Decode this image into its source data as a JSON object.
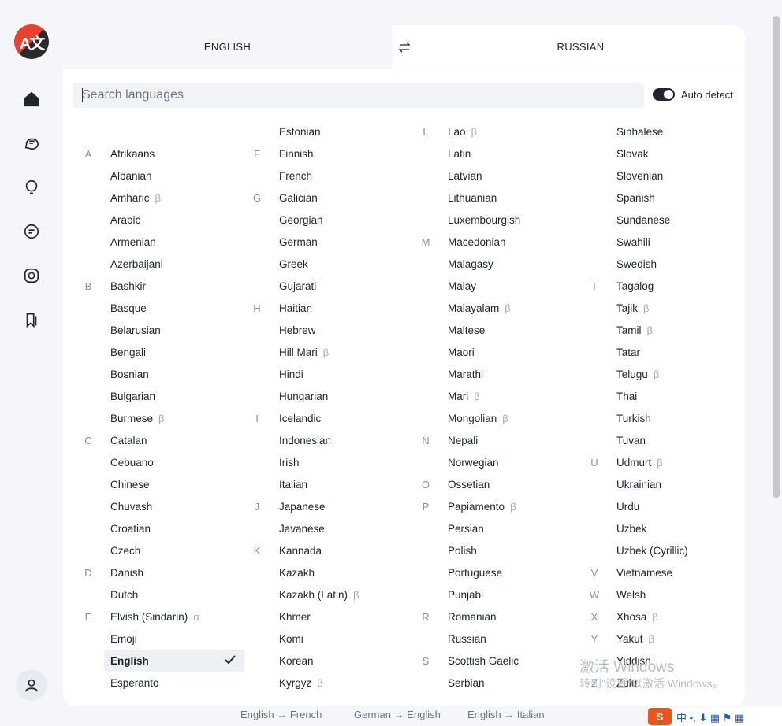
{
  "app": {
    "logo_icon": "translate-logo-icon",
    "logo_glyph": "A文"
  },
  "nav": {
    "items": [
      {
        "name": "home-icon"
      },
      {
        "name": "chat-bubbles-icon"
      },
      {
        "name": "lightbulb-icon"
      },
      {
        "name": "message-square-icon"
      },
      {
        "name": "camera-icon"
      },
      {
        "name": "bookmarks-icon"
      }
    ],
    "profile_icon": "user-icon"
  },
  "tabs": {
    "source": "ENGLISH",
    "target": "RUSSIAN",
    "swap_icon": "swap-arrows-icon"
  },
  "search": {
    "placeholder": "Search languages",
    "value": ""
  },
  "auto_detect": {
    "label": "Auto detect",
    "enabled": true
  },
  "beta_symbol": "β",
  "alpha_symbol": "α",
  "selected_language": "English",
  "columns": [
    [
      {
        "letter": "",
        "name": ""
      },
      {
        "letter": "A",
        "name": "Afrikaans"
      },
      {
        "letter": "",
        "name": "Albanian"
      },
      {
        "letter": "",
        "name": "Amharic",
        "tag": "β"
      },
      {
        "letter": "",
        "name": "Arabic"
      },
      {
        "letter": "",
        "name": "Armenian"
      },
      {
        "letter": "",
        "name": "Azerbaijani"
      },
      {
        "letter": "B",
        "name": "Bashkir"
      },
      {
        "letter": "",
        "name": "Basque"
      },
      {
        "letter": "",
        "name": "Belarusian"
      },
      {
        "letter": "",
        "name": "Bengali"
      },
      {
        "letter": "",
        "name": "Bosnian"
      },
      {
        "letter": "",
        "name": "Bulgarian"
      },
      {
        "letter": "",
        "name": "Burmese",
        "tag": "β"
      },
      {
        "letter": "C",
        "name": "Catalan"
      },
      {
        "letter": "",
        "name": "Cebuano"
      },
      {
        "letter": "",
        "name": "Chinese"
      },
      {
        "letter": "",
        "name": "Chuvash"
      },
      {
        "letter": "",
        "name": "Croatian"
      },
      {
        "letter": "",
        "name": "Czech"
      },
      {
        "letter": "D",
        "name": "Danish"
      },
      {
        "letter": "",
        "name": "Dutch"
      },
      {
        "letter": "E",
        "name": "Elvish (Sindarin)",
        "tag": "α"
      },
      {
        "letter": "",
        "name": "Emoji"
      },
      {
        "letter": "",
        "name": "English",
        "selected": true
      },
      {
        "letter": "",
        "name": "Esperanto"
      }
    ],
    [
      {
        "letter": "",
        "name": "Estonian"
      },
      {
        "letter": "F",
        "name": "Finnish"
      },
      {
        "letter": "",
        "name": "French"
      },
      {
        "letter": "G",
        "name": "Galician"
      },
      {
        "letter": "",
        "name": "Georgian"
      },
      {
        "letter": "",
        "name": "German"
      },
      {
        "letter": "",
        "name": "Greek"
      },
      {
        "letter": "",
        "name": "Gujarati"
      },
      {
        "letter": "H",
        "name": "Haitian"
      },
      {
        "letter": "",
        "name": "Hebrew"
      },
      {
        "letter": "",
        "name": "Hill Mari",
        "tag": "β"
      },
      {
        "letter": "",
        "name": "Hindi"
      },
      {
        "letter": "",
        "name": "Hungarian"
      },
      {
        "letter": "I",
        "name": "Icelandic"
      },
      {
        "letter": "",
        "name": "Indonesian"
      },
      {
        "letter": "",
        "name": "Irish"
      },
      {
        "letter": "",
        "name": "Italian"
      },
      {
        "letter": "J",
        "name": "Japanese"
      },
      {
        "letter": "",
        "name": "Javanese"
      },
      {
        "letter": "K",
        "name": "Kannada"
      },
      {
        "letter": "",
        "name": "Kazakh"
      },
      {
        "letter": "",
        "name": "Kazakh (Latin)",
        "tag": "β"
      },
      {
        "letter": "",
        "name": "Khmer"
      },
      {
        "letter": "",
        "name": "Komi"
      },
      {
        "letter": "",
        "name": "Korean"
      },
      {
        "letter": "",
        "name": "Kyrgyz",
        "tag": "β"
      }
    ],
    [
      {
        "letter": "L",
        "name": "Lao",
        "tag": "β"
      },
      {
        "letter": "",
        "name": "Latin"
      },
      {
        "letter": "",
        "name": "Latvian"
      },
      {
        "letter": "",
        "name": "Lithuanian"
      },
      {
        "letter": "",
        "name": "Luxembourgish"
      },
      {
        "letter": "M",
        "name": "Macedonian"
      },
      {
        "letter": "",
        "name": "Malagasy"
      },
      {
        "letter": "",
        "name": "Malay"
      },
      {
        "letter": "",
        "name": "Malayalam",
        "tag": "β"
      },
      {
        "letter": "",
        "name": "Maltese"
      },
      {
        "letter": "",
        "name": "Maori"
      },
      {
        "letter": "",
        "name": "Marathi"
      },
      {
        "letter": "",
        "name": "Mari",
        "tag": "β"
      },
      {
        "letter": "",
        "name": "Mongolian",
        "tag": "β"
      },
      {
        "letter": "N",
        "name": "Nepali"
      },
      {
        "letter": "",
        "name": "Norwegian"
      },
      {
        "letter": "O",
        "name": "Ossetian"
      },
      {
        "letter": "P",
        "name": "Papiamento",
        "tag": "β"
      },
      {
        "letter": "",
        "name": "Persian"
      },
      {
        "letter": "",
        "name": "Polish"
      },
      {
        "letter": "",
        "name": "Portuguese"
      },
      {
        "letter": "",
        "name": "Punjabi"
      },
      {
        "letter": "R",
        "name": "Romanian"
      },
      {
        "letter": "",
        "name": "Russian"
      },
      {
        "letter": "S",
        "name": "Scottish Gaelic"
      },
      {
        "letter": "",
        "name": "Serbian"
      }
    ],
    [
      {
        "letter": "",
        "name": "Sinhalese"
      },
      {
        "letter": "",
        "name": "Slovak"
      },
      {
        "letter": "",
        "name": "Slovenian"
      },
      {
        "letter": "",
        "name": "Spanish"
      },
      {
        "letter": "",
        "name": "Sundanese"
      },
      {
        "letter": "",
        "name": "Swahili"
      },
      {
        "letter": "",
        "name": "Swedish"
      },
      {
        "letter": "T",
        "name": "Tagalog"
      },
      {
        "letter": "",
        "name": "Tajik",
        "tag": "β"
      },
      {
        "letter": "",
        "name": "Tamil",
        "tag": "β"
      },
      {
        "letter": "",
        "name": "Tatar"
      },
      {
        "letter": "",
        "name": "Telugu",
        "tag": "β"
      },
      {
        "letter": "",
        "name": "Thai"
      },
      {
        "letter": "",
        "name": "Turkish"
      },
      {
        "letter": "",
        "name": "Tuvan"
      },
      {
        "letter": "U",
        "name": "Udmurt",
        "tag": "β"
      },
      {
        "letter": "",
        "name": "Ukrainian"
      },
      {
        "letter": "",
        "name": "Urdu"
      },
      {
        "letter": "",
        "name": "Uzbek"
      },
      {
        "letter": "",
        "name": "Uzbek (Cyrillic)"
      },
      {
        "letter": "V",
        "name": "Vietnamese"
      },
      {
        "letter": "W",
        "name": "Welsh"
      },
      {
        "letter": "X",
        "name": "Xhosa",
        "tag": "β"
      },
      {
        "letter": "Y",
        "name": "Yakut",
        "tag": "β"
      },
      {
        "letter": "",
        "name": "Yiddish"
      },
      {
        "letter": "Z",
        "name": "Zulu"
      }
    ]
  ],
  "footer": {
    "links": [
      "English → French",
      "German → English",
      "English → Italian"
    ]
  },
  "os_overlay": {
    "watermark_line1": "激活 Windows",
    "watermark_line2": "转到\"设置\"以激活 Windows。",
    "ime_badge": "S",
    "ime_text": "中 •, ⬇ ▦ ⚑ ▦"
  },
  "colors": {
    "logo_red": "#e9402f",
    "accent_dark": "#21262d",
    "panel_bg": "#ffffff",
    "page_bg": "#f4f6fa"
  }
}
